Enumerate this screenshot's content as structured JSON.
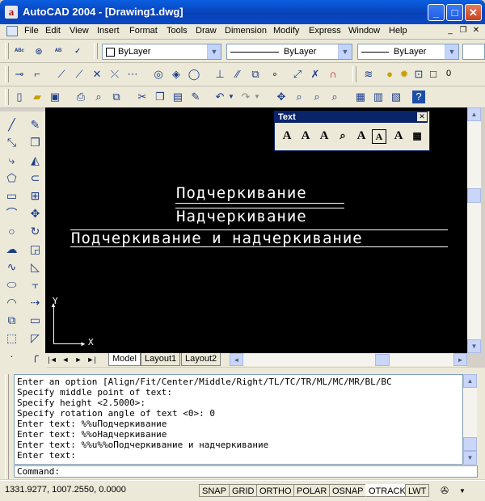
{
  "window": {
    "title": "AutoCAD 2004 - [Drawing1.dwg]",
    "app_icon_letter": "a",
    "min_glyph": "_",
    "max_glyph": "□",
    "close_glyph": "✕"
  },
  "menu": {
    "items": [
      "File",
      "Edit",
      "View",
      "Insert",
      "Format",
      "Tools",
      "Draw",
      "Dimension",
      "Modify",
      "Express",
      "Window",
      "Help"
    ],
    "doc_controls": [
      "_",
      "❐",
      "✕"
    ]
  },
  "properties": {
    "color_value": "ByLayer",
    "linetype_value": "ByLayer",
    "lineweight_value": "ByLayer",
    "layer_value": "0"
  },
  "text_toolbar": {
    "title": "Text",
    "close": "✕",
    "icons": [
      "single-line-text-icon",
      "multiline-text-icon",
      "edit-text-icon",
      "find-replace-icon",
      "text-style-icon",
      "scale-text-icon",
      "justify-text-icon",
      "convert-distance-icon"
    ]
  },
  "drawing": {
    "text_underline": "Подчеркивание",
    "text_overline": "Надчеркивание",
    "text_both": "Подчеркивание и надчеркивание",
    "ucs_x": "X",
    "ucs_y": "Y"
  },
  "layout_tabs": {
    "nav": [
      "|◄",
      "◄",
      "►",
      "►|"
    ],
    "tabs": [
      "Model",
      "Layout1",
      "Layout2"
    ],
    "active": "Model"
  },
  "command_history": [
    "Enter an option [Align/Fit/Center/Middle/Right/TL/TC/TR/ML/MC/MR/BL/BC",
    "Specify middle point of text:",
    "Specify height <2.5000>:",
    "Specify rotation angle of text <0>: 0",
    "Enter text: %%uПодчеркивание",
    "Enter text: %%oНадчеркивание",
    "Enter text: %%u%%oПодчеркивание и надчеркивание",
    "Enter text:"
  ],
  "command_prompt": "Command:",
  "status": {
    "coordinates": "1331.9277, 1007.2550, 0.0000",
    "toggles": [
      {
        "label": "SNAP",
        "on": false
      },
      {
        "label": "GRID",
        "on": false
      },
      {
        "label": "ORTHO",
        "on": false
      },
      {
        "label": "POLAR",
        "on": false
      },
      {
        "label": "OSNAP",
        "on": false
      },
      {
        "label": "OTRACK",
        "on": true
      },
      {
        "label": "LWT",
        "on": false
      }
    ]
  }
}
